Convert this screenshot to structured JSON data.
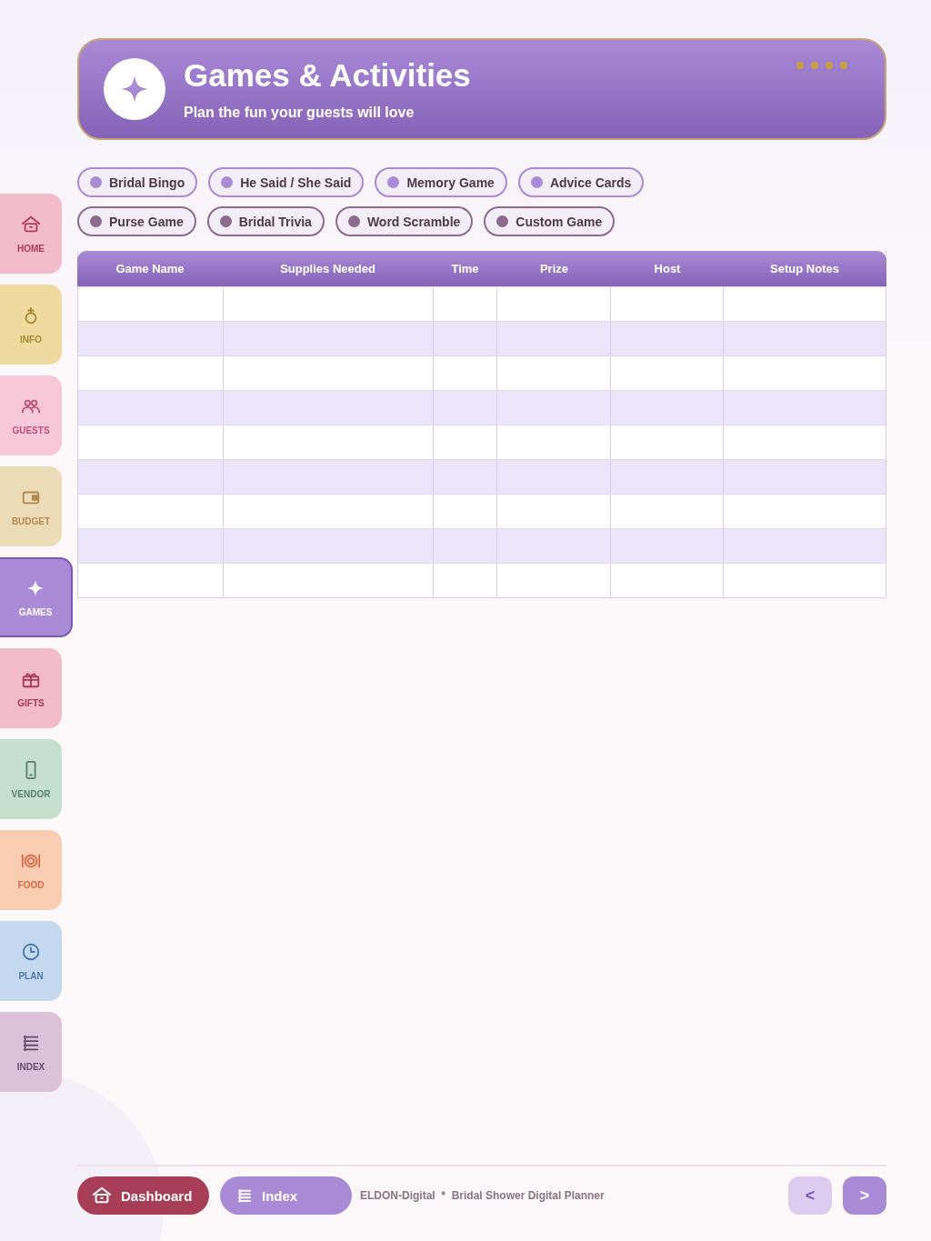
{
  "header": {
    "title": "Games & Activities",
    "subtitle": "Plan the fun your guests will love"
  },
  "nav": [
    {
      "kind": "home",
      "label": "HOME",
      "color": "#b03a5b",
      "selected": false
    },
    {
      "kind": "info",
      "label": "INFO",
      "color": "#a8862e",
      "selected": false
    },
    {
      "kind": "guests",
      "label": "GUESTS",
      "color": "#c0507a",
      "selected": false
    },
    {
      "kind": "budget",
      "label": "BUDGET",
      "color": "#b08a4e",
      "selected": false
    },
    {
      "kind": "games",
      "label": "GAMES",
      "color": "#ffffff",
      "selected": true
    },
    {
      "kind": "gifts",
      "label": "GIFTS",
      "color": "#a83a55",
      "selected": false
    },
    {
      "kind": "vendor",
      "label": "VENDOR",
      "color": "#5a8065",
      "selected": false
    },
    {
      "kind": "food",
      "label": "FOOD",
      "color": "#d86a48",
      "selected": false
    },
    {
      "kind": "plan",
      "label": "PLAN",
      "color": "#4a78a8",
      "selected": false
    },
    {
      "kind": "index",
      "label": "INDEX",
      "color": "#6a4a68",
      "selected": false
    }
  ],
  "chip_rows": [
    [
      {
        "label": "Bridal Bingo",
        "color": "#a98ad6"
      },
      {
        "label": "He Said / She Said",
        "color": "#a98ad6"
      },
      {
        "label": "Memory Game",
        "color": "#a98ad6"
      },
      {
        "label": "Advice Cards",
        "color": "#a98ad6"
      }
    ],
    [
      {
        "label": "Purse Game",
        "color": "#8e6a8e"
      },
      {
        "label": "Bridal Trivia",
        "color": "#8e6a8e"
      },
      {
        "label": "Word Scramble",
        "color": "#8e6a8e"
      },
      {
        "label": "Custom Game",
        "color": "#8e6a8e"
      }
    ]
  ],
  "table": {
    "columns": [
      "Game Name",
      "Supplies Needed",
      "Time",
      "Prize",
      "Host",
      "Setup Notes"
    ],
    "rows": [
      {
        "shaded": false
      },
      {
        "shaded": true
      },
      {
        "shaded": false
      },
      {
        "shaded": true
      },
      {
        "shaded": false
      },
      {
        "shaded": true
      },
      {
        "shaded": false
      },
      {
        "shaded": true
      },
      {
        "shaded": false
      }
    ]
  },
  "footer": {
    "dashboard": "Dashboard",
    "index": "Index",
    "credit": "ELDON-Digital  *  Bridal Shower Digital Planner",
    "prev": "<",
    "next": ">"
  }
}
